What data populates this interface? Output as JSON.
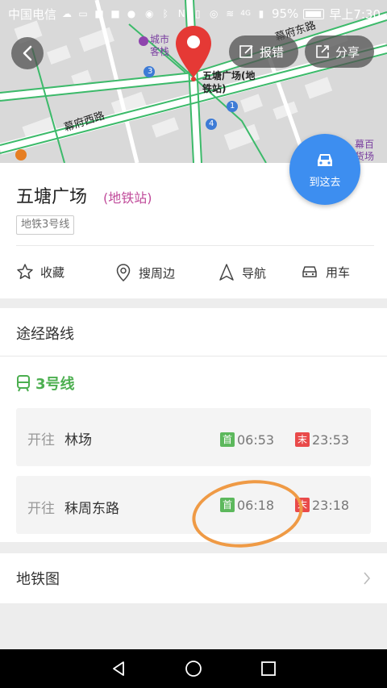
{
  "status_bar": {
    "carrier": "中国电信",
    "battery_percent": "95%",
    "time": "早上7:30",
    "signal_type": "4G"
  },
  "map": {
    "road_labels": [
      "幕府西路",
      "幕府东路"
    ],
    "poi_labels": [
      "城市客栈",
      "幕百货场"
    ],
    "marker_label_line1": "五塘广场(地",
    "marker_label_line2": "铁站)",
    "number_markers": [
      "3",
      "1",
      "4"
    ],
    "report_button": "报错",
    "share_button": "分享"
  },
  "place": {
    "name": "五塘广场",
    "type": "(地铁站)",
    "line_tag": "地铁3号线",
    "go_button": "到这去"
  },
  "actions": [
    {
      "label": "收藏",
      "icon": "star-icon"
    },
    {
      "label": "搜周边",
      "icon": "location-pin-icon"
    },
    {
      "label": "导航",
      "icon": "navigation-arrow-icon"
    },
    {
      "label": "用车",
      "icon": "car-icon"
    }
  ],
  "route": {
    "section_title": "途经路线",
    "line_name": "3号线",
    "directions": [
      {
        "prefix": "开往",
        "destination": "林场",
        "first_badge": "首",
        "first_time": "06:53",
        "last_badge": "末",
        "last_time": "23:53"
      },
      {
        "prefix": "开往",
        "destination": "秣周东路",
        "first_badge": "首",
        "first_time": "06:18",
        "last_badge": "末",
        "last_time": "23:18"
      }
    ]
  },
  "metro_map": {
    "label": "地铁图"
  },
  "colors": {
    "accent_blue": "#3d8ef0",
    "line_green": "#4caf50",
    "pin_red": "#e53935",
    "first_badge": "#5cb85c",
    "last_badge": "#e94a4a",
    "annotation_orange": "#ef9a45"
  }
}
